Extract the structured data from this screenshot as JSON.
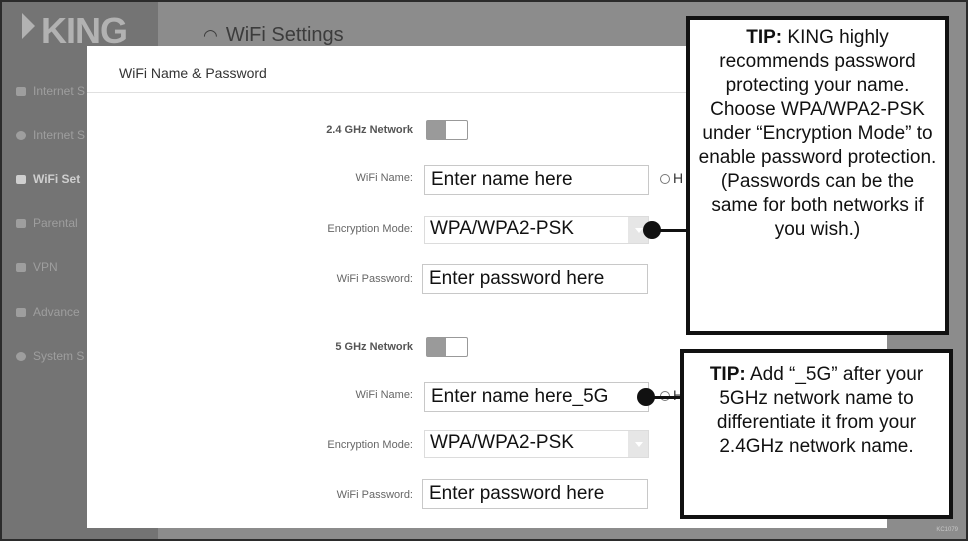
{
  "app": {
    "logo": "KING",
    "page_title": "WiFi Settings"
  },
  "sidebar": {
    "items": [
      {
        "label": "Internet S",
        "icon": "lock-icon"
      },
      {
        "label": "Internet S",
        "icon": "globe-icon"
      },
      {
        "label": "WiFi Set",
        "icon": "wifi-icon",
        "active": true
      },
      {
        "label": "Parental",
        "icon": "family-icon"
      },
      {
        "label": "VPN",
        "icon": "vpn-icon"
      },
      {
        "label": "Advance",
        "icon": "tools-icon"
      },
      {
        "label": "System S",
        "icon": "gear-icon"
      }
    ]
  },
  "modal": {
    "title": "WiFi Name & Password",
    "net24": {
      "label": "2.4 GHz Network",
      "wifi_name_label": "WiFi Name:",
      "wifi_name_value": "Enter name here",
      "hide_label": "H",
      "enc_label": "Encryption Mode:",
      "enc_value": "WPA/WPA2-PSK",
      "pwd_label": "WiFi Password:",
      "pwd_value": "Enter password here"
    },
    "net5": {
      "label": "5 GHz Network",
      "wifi_name_label": "WiFi Name:",
      "wifi_name_value": "Enter name here_5G",
      "hide_label": "H",
      "enc_label": "Encryption Mode:",
      "enc_value": "WPA/WPA2-PSK",
      "pwd_label": "WiFi Password:",
      "pwd_value": "Enter password here"
    }
  },
  "tip1": {
    "prefix": "TIP:",
    "text": "KING highly recommends password protecting your name. Choose WPA/WPA2-PSK under “Encryption Mode” to enable password protection. (Passwords can be the same for both networks if you wish.)"
  },
  "tip2": {
    "prefix": "TIP:",
    "text": "Add “_5G” after your 5GHz network name to differentiate it from your 2.4GHz network name."
  },
  "footer_code": "KC1079"
}
